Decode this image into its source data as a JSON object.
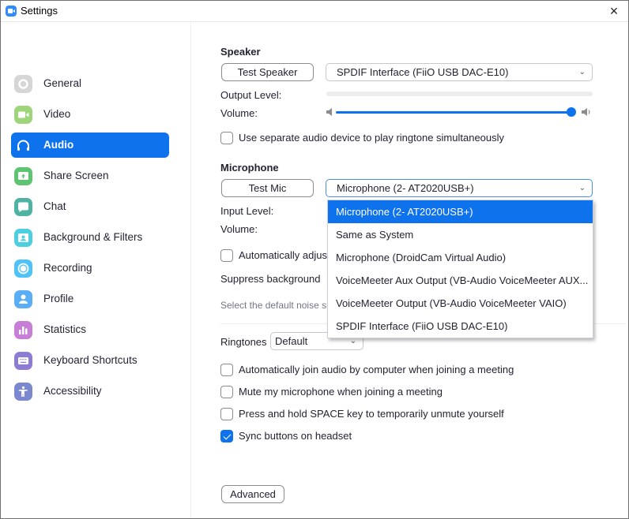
{
  "window": {
    "title": "Settings",
    "close_icon": "×"
  },
  "sidebar": {
    "items": [
      {
        "label": "General",
        "icon": "gear-icon",
        "color": "#d6d6d6",
        "active": false
      },
      {
        "label": "Video",
        "icon": "video-camera-icon",
        "color": "#9ed47a",
        "active": false
      },
      {
        "label": "Audio",
        "icon": "headphones-icon",
        "color": "#0e72ed",
        "active": true
      },
      {
        "label": "Share Screen",
        "icon": "share-screen-icon",
        "color": "#5fc472",
        "active": false
      },
      {
        "label": "Chat",
        "icon": "chat-bubble-icon",
        "color": "#4fb3a4",
        "active": false
      },
      {
        "label": "Background & Filters",
        "icon": "background-icon",
        "color": "#4dcfe0",
        "active": false
      },
      {
        "label": "Recording",
        "icon": "record-icon",
        "color": "#4fc3f7",
        "active": false
      },
      {
        "label": "Profile",
        "icon": "profile-icon",
        "color": "#5aaef5",
        "active": false
      },
      {
        "label": "Statistics",
        "icon": "bar-chart-icon",
        "color": "#c67fd4",
        "active": false
      },
      {
        "label": "Keyboard Shortcuts",
        "icon": "keyboard-icon",
        "color": "#8e7cd4",
        "active": false
      },
      {
        "label": "Accessibility",
        "icon": "accessibility-icon",
        "color": "#7b87cf",
        "active": false
      }
    ]
  },
  "speaker": {
    "title": "Speaker",
    "test_button": "Test Speaker",
    "device": "SPDIF Interface (FiiO USB DAC-E10)",
    "output_level_label": "Output Level:",
    "output_level": 0,
    "volume_label": "Volume:",
    "volume": 0.96,
    "separate_device_label": "Use separate audio device to play ringtone simultaneously",
    "separate_device_checked": false
  },
  "microphone": {
    "title": "Microphone",
    "test_button": "Test Mic",
    "device": "Microphone (2- AT2020USB+)",
    "input_level_label": "Input Level:",
    "volume_label": "Volume:",
    "auto_adjust_label": "Automatically adjus",
    "auto_adjust_checked": false,
    "suppress_label": "Suppress background",
    "suppress_hint": "Select the default noise su",
    "dropdown_options": [
      {
        "label": "Microphone (2- AT2020USB+)",
        "selected": true
      },
      {
        "label": "Same as System",
        "selected": false
      },
      {
        "label": "Microphone (DroidCam Virtual Audio)",
        "selected": false
      },
      {
        "label": "VoiceMeeter Aux Output (VB-Audio VoiceMeeter AUX...",
        "selected": false
      },
      {
        "label": "VoiceMeeter Output (VB-Audio VoiceMeeter VAIO)",
        "selected": false
      },
      {
        "label": "SPDIF Interface (FiiO USB DAC-E10)",
        "selected": false
      }
    ]
  },
  "ringtones": {
    "label": "Ringtones",
    "value": "Default"
  },
  "options": [
    {
      "label": "Automatically join audio by computer when joining a meeting",
      "checked": false
    },
    {
      "label": "Mute my microphone when joining a meeting",
      "checked": false
    },
    {
      "label": "Press and hold SPACE key to temporarily unmute yourself",
      "checked": false
    },
    {
      "label": "Sync buttons on headset",
      "checked": true
    }
  ],
  "advanced_button": "Advanced",
  "colors": {
    "accent": "#0e72ed"
  }
}
